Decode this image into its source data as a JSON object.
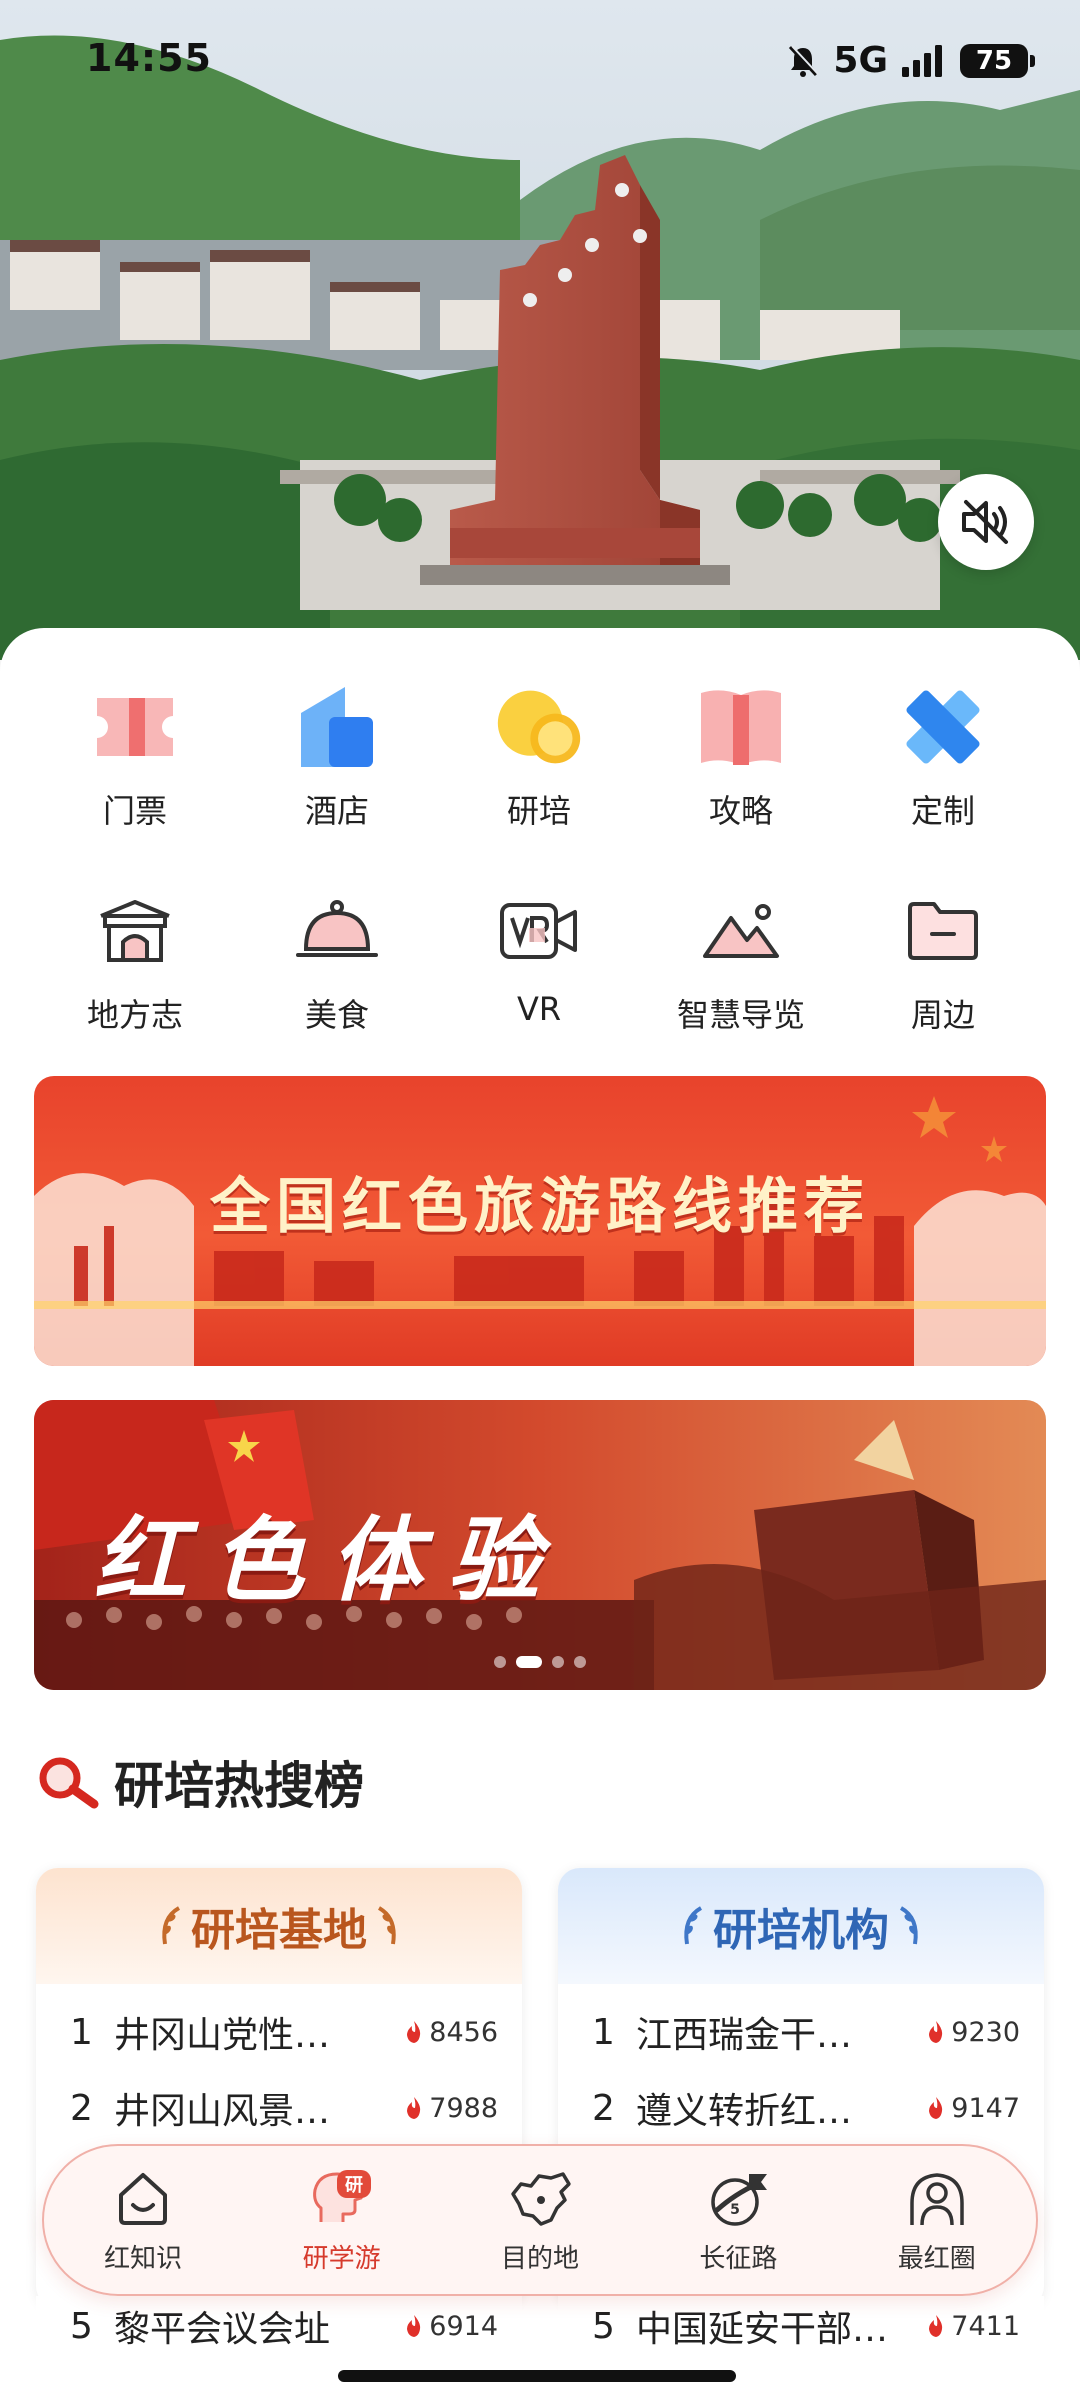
{
  "status_bar": {
    "time": "14:55",
    "network": "5G",
    "battery": "75"
  },
  "hero": {
    "mute_icon": "speaker-muted-icon"
  },
  "quick_grid": {
    "row1": [
      {
        "label": "门票",
        "icon": "ticket-icon",
        "color": "#f08c8c"
      },
      {
        "label": "酒店",
        "icon": "hotel-icon",
        "color": "#3e8ef5"
      },
      {
        "label": "研培",
        "icon": "study-icon",
        "color": "#f7c634"
      },
      {
        "label": "攻略",
        "icon": "guide-book-icon",
        "color": "#f07a7a"
      },
      {
        "label": "定制",
        "icon": "custom-icon",
        "color": "#3b8df0"
      }
    ],
    "row2": [
      {
        "label": "地方志",
        "icon": "gate-icon"
      },
      {
        "label": "美食",
        "icon": "food-cloche-icon"
      },
      {
        "label": "VR",
        "icon": "vr-camera-icon"
      },
      {
        "label": "智慧导览",
        "icon": "mountain-icon"
      },
      {
        "label": "周边",
        "icon": "folder-icon"
      }
    ]
  },
  "banners": [
    {
      "title": "全国红色旅游路线推荐"
    },
    {
      "title": "红色体验",
      "pages": 4,
      "active_page": 2
    }
  ],
  "hot_search": {
    "title": "研培热搜榜",
    "cards": [
      {
        "title": "研培基地",
        "theme": "#e87a3a",
        "items": [
          {
            "rank": "1",
            "name": "井冈山党性…",
            "hot": "8456"
          },
          {
            "rank": "2",
            "name": "井冈山风景…",
            "hot": "7988"
          },
          {
            "rank": "5",
            "name": "黎平会议会址",
            "hot": "6914"
          }
        ]
      },
      {
        "title": "研培机构",
        "theme": "#3f77c8",
        "items": [
          {
            "rank": "1",
            "name": "江西瑞金干…",
            "hot": "9230"
          },
          {
            "rank": "2",
            "name": "遵义转折红…",
            "hot": "9147"
          },
          {
            "rank": "5",
            "name": "中国延安干部…",
            "hot": "7411"
          }
        ]
      }
    ]
  },
  "tabbar": {
    "items": [
      {
        "label": "红知识",
        "icon": "house-smile-icon"
      },
      {
        "label": "研学游",
        "icon": "study-head-icon",
        "badge": "研",
        "active": true
      },
      {
        "label": "目的地",
        "icon": "china-map-icon"
      },
      {
        "label": "长征路",
        "icon": "long-march-icon"
      },
      {
        "label": "最红圈",
        "icon": "circle-people-icon"
      }
    ]
  },
  "colors": {
    "accent": "#d63a2c",
    "hot_flame": "#e0302a"
  }
}
